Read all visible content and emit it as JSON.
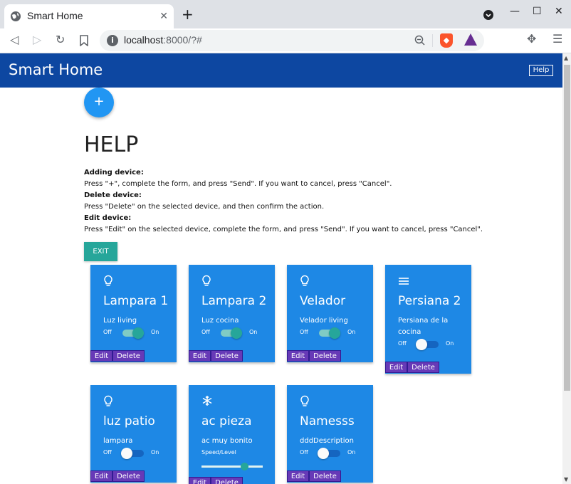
{
  "browser": {
    "tab_title": "Smart Home",
    "tab_close": "✕",
    "new_tab": "+",
    "url_host": "localhost",
    "url_rest": ":8000/?#",
    "win_minimize": "—",
    "win_maximize": "☐",
    "win_close": "✕"
  },
  "app": {
    "title": "Smart Home",
    "help_label": "Help",
    "fab_label": "+"
  },
  "help": {
    "heading": "HELP",
    "sections": [
      {
        "title": "Adding device:",
        "text": "Press \"+\", complete the form, and press \"Send\". If you want to cancel, press \"Cancel\"."
      },
      {
        "title": "Delete device:",
        "text": "Press \"Delete\" on the selected device, and then confirm the action."
      },
      {
        "title": "Edit device:",
        "text": "Press \"Edit\" on the selected device, complete the form, and press \"Send\". If you want to cancel, press \"Cancel\"."
      }
    ],
    "exit_label": "EXIT"
  },
  "labels": {
    "off": "Off",
    "on": "On",
    "edit": "Edit",
    "delete": "Delete",
    "speed_level": "Speed/Level"
  },
  "devices": [
    {
      "icon": "lightbulb-icon",
      "name": "Lampara 1",
      "description": "Luz living",
      "state": true
    },
    {
      "icon": "lightbulb-icon",
      "name": "Lampara 2",
      "description": "Luz cocina",
      "state": true
    },
    {
      "icon": "lightbulb-icon",
      "name": "Velador",
      "description": "Velador living",
      "state": true
    },
    {
      "icon": "blinds-icon",
      "name": "Persiana 2",
      "description": "Persiana de la cocina",
      "state": false
    },
    {
      "icon": "lightbulb-icon",
      "name": "luz patio",
      "description": "lampara",
      "state": false
    },
    {
      "icon": "snowflake-icon",
      "name": "ac pieza",
      "description": "ac muy bonito",
      "level": 0.7
    },
    {
      "icon": "lightbulb-icon",
      "name": "Namesss",
      "description": "dddDescription",
      "state": false
    }
  ],
  "colors": {
    "header": "#0d47a1",
    "card": "#1e88e5",
    "fab": "#2196f3",
    "exit": "#26a69a",
    "action_button": "#673ab7"
  }
}
